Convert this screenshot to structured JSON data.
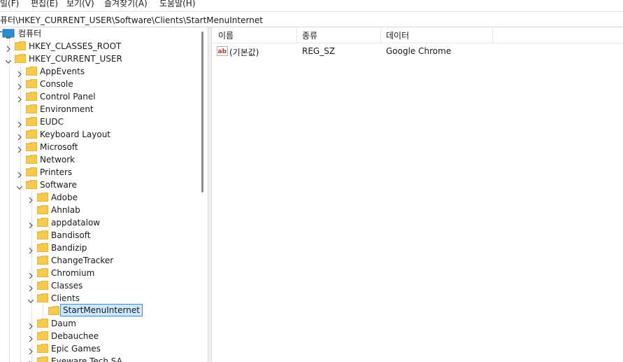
{
  "menu": {
    "file": "일(F)",
    "edit": "편집(E)",
    "view": "보기(V)",
    "favorites": "즐겨찾기(A)",
    "help": "도움말(H)"
  },
  "address": "퓨터\\HKEY_CURRENT_USER\\Software\\Clients\\StartMenuInternet",
  "tree": {
    "computer": "컴퓨터",
    "classes_root": "HKEY_CLASSES_ROOT",
    "current_user": "HKEY_CURRENT_USER",
    "appevents": "AppEvents",
    "console": "Console",
    "control_panel": "Control Panel",
    "environment": "Environment",
    "eudc": "EUDC",
    "keyboard_layout": "Keyboard Layout",
    "microsoft": "Microsoft",
    "network": "Network",
    "printers": "Printers",
    "software": "Software",
    "adobe": "Adobe",
    "ahnlab": "Ahnlab",
    "appdatalow": "appdatalow",
    "bandisoft": "Bandisoft",
    "bandizip": "Bandizip",
    "changetracker": "ChangeTracker",
    "chromium": "Chromium",
    "classes": "Classes",
    "clients": "Clients",
    "startmenuinternet": "StartMenuInternet",
    "daum": "Daum",
    "debauchee": "Debauchee",
    "epic_games": "Epic Games",
    "eyeware": "Eyeware Tech SA"
  },
  "list": {
    "headers": {
      "name": "이름",
      "type": "종류",
      "data": "데이터"
    },
    "rows": [
      {
        "name": "(기본값)",
        "type": "REG_SZ",
        "data": "Google Chrome"
      }
    ]
  }
}
